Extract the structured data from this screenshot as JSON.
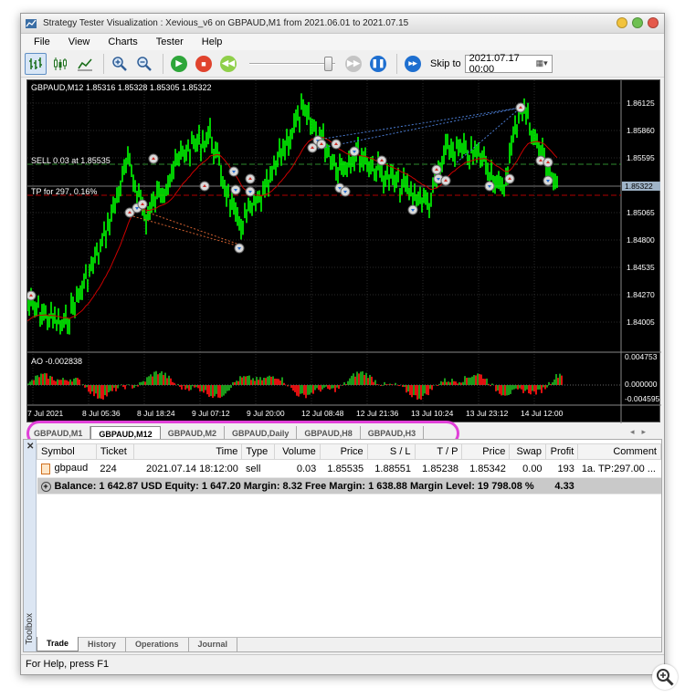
{
  "window": {
    "title": "Strategy Tester Visualization : Xevious_v6 on GBPAUD,M1 from 2021.06.01 to 2021.07.15"
  },
  "menu": [
    "File",
    "View",
    "Charts",
    "Tester",
    "Help"
  ],
  "toolbar": {
    "skip_label": "Skip to",
    "skip_date": "2021.07.17 00:00"
  },
  "chart": {
    "header": "GBPAUD,M12  1.85316 1.85328 1.85305 1.85322",
    "sell_label": "SELL 0.03 at 1.85535",
    "tp_label": "TP for 297, 0.16%",
    "price_ticks": [
      "1.86125",
      "1.85860",
      "1.85595",
      "1.85065",
      "1.84800",
      "1.84535",
      "1.84270",
      "1.84005"
    ],
    "current_price": "1.85322",
    "ao_label": "AO -0.002838",
    "ao_ticks": [
      "0.004753",
      "0.000000",
      "-0.004595"
    ],
    "time_ticks": [
      "7 Jul 2021",
      "8 Jul 05:36",
      "8 Jul 18:24",
      "9 Jul 07:12",
      "9 Jul 20:00",
      "12 Jul 08:48",
      "12 Jul 21:36",
      "13 Jul 10:24",
      "13 Jul 23:12",
      "14 Jul 12:00"
    ],
    "colors": {
      "candles": "#00ff00",
      "ma": "#cc0000",
      "grid": "#2a2a2a"
    }
  },
  "chart_tabs": [
    "GBPAUD,M1",
    "GBPAUD,M12",
    "GBPAUD,M2",
    "GBPAUD,Daily",
    "GBPAUD,H8",
    "GBPAUD,H3"
  ],
  "active_chart_tab": "GBPAUD,M12",
  "trade": {
    "columns": [
      "Symbol",
      "Ticket",
      "Time",
      "Type",
      "Volume",
      "Price",
      "S / L",
      "T / P",
      "Price",
      "Swap",
      "Profit",
      "Comment"
    ],
    "rows": [
      {
        "symbol": "gbpaud",
        "ticket": "224",
        "time": "2021.07.14 18:12:00",
        "type": "sell",
        "volume": "0.03",
        "price": "1.85535",
        "sl": "1.88551",
        "tp": "1.85238",
        "cur_price": "1.85342",
        "swap": "0.00",
        "profit": "193",
        "comment": "1a. TP:297.00 ..."
      }
    ],
    "summary": "Balance: 1 642.87 USD  Equity: 1 647.20  Margin: 8.32  Free Margin: 1 638.88  Margin Level: 19 798.08 %",
    "summary_profit": "4.33"
  },
  "toolbox_label": "Toolbox",
  "bottom_tabs": [
    "Trade",
    "History",
    "Operations",
    "Journal"
  ],
  "status": "For Help, press F1"
}
